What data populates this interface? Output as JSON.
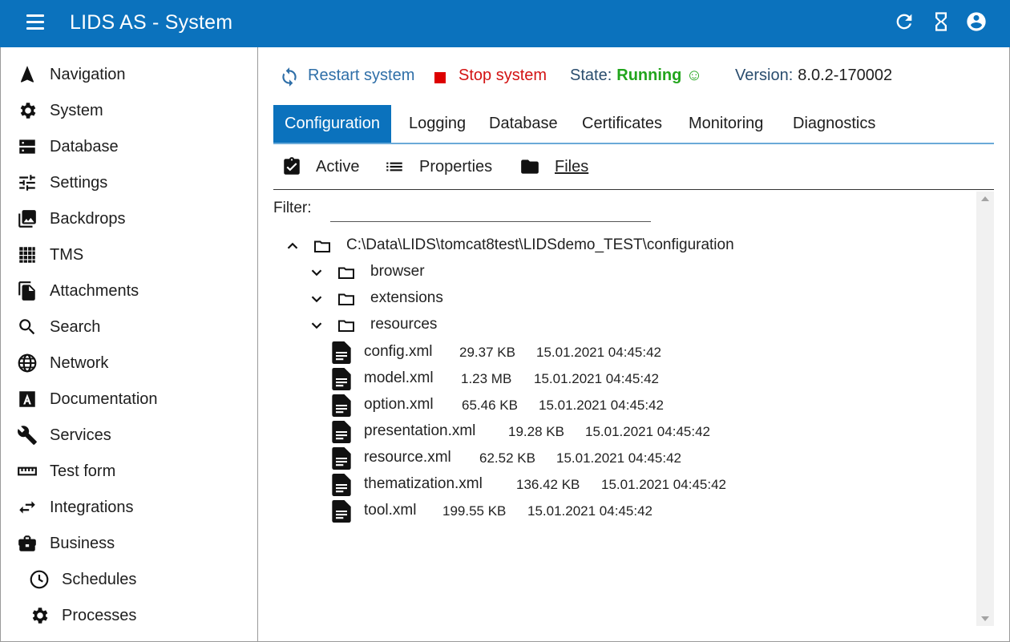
{
  "appbar": {
    "title": "LIDS AS - System",
    "actions": [
      "refresh-icon",
      "hourglass-icon",
      "account-icon"
    ]
  },
  "sidebar": {
    "items": [
      {
        "label": "Navigation",
        "icon": "navigation-arrow-icon"
      },
      {
        "label": "System",
        "icon": "gear-icon"
      },
      {
        "label": "Database",
        "icon": "database-icon"
      },
      {
        "label": "Settings",
        "icon": "sliders-icon"
      },
      {
        "label": "Backdrops",
        "icon": "image-stack-icon"
      },
      {
        "label": "TMS",
        "icon": "grid-icon"
      },
      {
        "label": "Attachments",
        "icon": "files-icon"
      },
      {
        "label": "Search",
        "icon": "search-icon"
      },
      {
        "label": "Network",
        "icon": "globe-icon"
      },
      {
        "label": "Documentation",
        "icon": "letter-a-icon"
      },
      {
        "label": "Services",
        "icon": "wrench-icon"
      },
      {
        "label": "Test form",
        "icon": "ruler-icon"
      },
      {
        "label": "Integrations",
        "icon": "swap-arrows-icon"
      },
      {
        "label": "Business",
        "icon": "briefcase-icon"
      },
      {
        "label": "Schedules",
        "icon": "clock-icon"
      },
      {
        "label": "Processes",
        "icon": "gear-icon"
      }
    ]
  },
  "toolbar": {
    "restart_label": "Restart system",
    "stop_label": "Stop system",
    "state_label": "State:",
    "state_value": "Running ☺",
    "version_label": "Version:",
    "version_value": "8.0.2-170002"
  },
  "tabs": [
    {
      "label": "Configuration",
      "active": true
    },
    {
      "label": "Logging"
    },
    {
      "label": "Database"
    },
    {
      "label": "Certificates"
    },
    {
      "label": "Monitoring"
    },
    {
      "label": "Diagnostics"
    }
  ],
  "subtabs": [
    {
      "label": "Active",
      "icon": "clipboard-check-icon"
    },
    {
      "label": "Properties",
      "icon": "list-icon"
    },
    {
      "label": "Files",
      "icon": "folder-icon",
      "current": true
    }
  ],
  "filter": {
    "label": "Filter:",
    "value": "",
    "placeholder": ""
  },
  "tree": {
    "root": "C:\\Data\\LIDS\\tomcat8test\\LIDSdemo_TEST\\configuration",
    "folders": [
      "browser",
      "extensions",
      "resources"
    ],
    "files": [
      {
        "name": "config.xml",
        "size": "29.37 KB",
        "date": "15.01.2021 04:45:42"
      },
      {
        "name": "model.xml",
        "size": "1.23 MB",
        "date": "15.01.2021 04:45:42"
      },
      {
        "name": "option.xml",
        "size": "65.46 KB",
        "date": "15.01.2021 04:45:42"
      },
      {
        "name": "presentation.xml",
        "size": "19.28 KB",
        "date": "15.01.2021 04:45:42"
      },
      {
        "name": "resource.xml",
        "size": "62.52 KB",
        "date": "15.01.2021 04:45:42"
      },
      {
        "name": "thematization.xml",
        "size": "136.42 KB",
        "date": "15.01.2021 04:45:42"
      },
      {
        "name": "tool.xml",
        "size": "199.55 KB",
        "date": "15.01.2021 04:45:42"
      }
    ]
  },
  "colors": {
    "appbar": "#0b72bd",
    "running": "#22a51d",
    "stop": "#d31313",
    "restart": "#2f6fa8"
  }
}
